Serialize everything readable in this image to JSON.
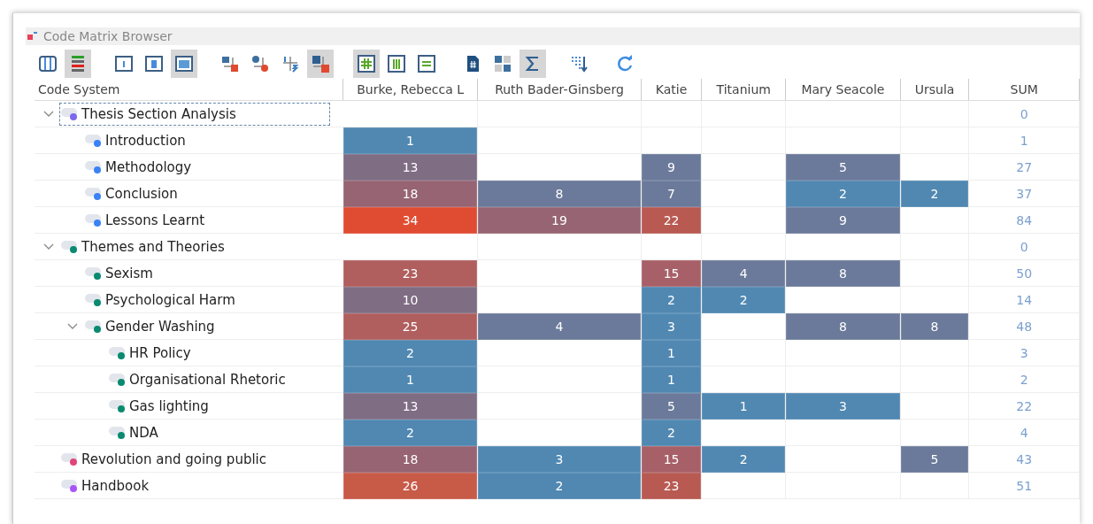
{
  "window": {
    "title": "Code Matrix Browser"
  },
  "toolbar": [
    [
      {
        "kind": "columns",
        "selected": false
      },
      {
        "kind": "bars",
        "selected": true
      }
    ],
    [
      {
        "kind": "frame-thin",
        "selected": false
      },
      {
        "kind": "frame-mid",
        "selected": false
      },
      {
        "kind": "frame-full",
        "selected": true
      }
    ],
    [
      {
        "kind": "square-link",
        "selected": false
      },
      {
        "kind": "circle-link",
        "selected": false
      },
      {
        "kind": "num-link",
        "selected": false
      },
      {
        "kind": "num-badge",
        "selected": true
      }
    ],
    [
      {
        "kind": "grid-hash",
        "selected": true
      },
      {
        "kind": "grid-cols",
        "selected": false
      },
      {
        "kind": "grid-rows",
        "selected": false
      }
    ],
    [
      {
        "kind": "doc-hash",
        "selected": false
      },
      {
        "kind": "tiles",
        "selected": false
      },
      {
        "kind": "sigma",
        "selected": true
      }
    ],
    [
      {
        "kind": "sort-down",
        "selected": false
      }
    ],
    [
      {
        "kind": "refresh",
        "selected": false
      }
    ]
  ],
  "columns": [
    "Code System",
    "Burke, Rebecca L",
    "Ruth Bader-Ginsberg",
    "Katie",
    "Titanium",
    "Mary Seacole",
    "Ursula",
    "SUM"
  ],
  "codes": [
    {
      "name": "Thesis Section Analysis",
      "color": "#7b68ee",
      "selected": true,
      "expanded": true,
      "cells": [
        null,
        null,
        null,
        null,
        null,
        null
      ],
      "sum": "0",
      "children": [
        {
          "name": "Introduction",
          "color": "#3b82f6",
          "selected": false,
          "cells": [
            {
              "value": "1",
              "color": "#5088b2"
            },
            null,
            null,
            null,
            null,
            null
          ],
          "sum": "1"
        },
        {
          "name": "Methodology",
          "color": "#3b82f6",
          "selected": false,
          "cells": [
            {
              "value": "13",
              "color": "#7f6d84"
            },
            null,
            {
              "value": "9",
              "color": "#6b7a9a"
            },
            null,
            {
              "value": "5",
              "color": "#6b7a9a"
            },
            null
          ],
          "sum": "27"
        },
        {
          "name": "Conclusion",
          "color": "#3b82f6",
          "selected": false,
          "cells": [
            {
              "value": "18",
              "color": "#966472"
            },
            {
              "value": "8",
              "color": "#6b7a9a"
            },
            {
              "value": "7",
              "color": "#6b7a9a"
            },
            null,
            {
              "value": "2",
              "color": "#5088b2"
            },
            {
              "value": "2",
              "color": "#5088b2"
            }
          ],
          "sum": "37"
        },
        {
          "name": "Lessons Learnt",
          "color": "#3b82f6",
          "selected": false,
          "cells": [
            {
              "value": "34",
              "color": "#e04c32"
            },
            {
              "value": "19",
              "color": "#966472"
            },
            {
              "value": "22",
              "color": "#b85a52"
            },
            null,
            {
              "value": "9",
              "color": "#6b7a9a"
            },
            null
          ],
          "sum": "84"
        }
      ]
    },
    {
      "name": "Themes and Theories",
      "color": "#0a8a70",
      "selected": false,
      "expanded": true,
      "cells": [
        null,
        null,
        null,
        null,
        null,
        null
      ],
      "sum": "0",
      "children": [
        {
          "name": "Sexism",
          "color": "#0a8a70",
          "selected": false,
          "cells": [
            {
              "value": "23",
              "color": "#b05e5e"
            },
            null,
            {
              "value": "15",
              "color": "#a86068"
            },
            {
              "value": "4",
              "color": "#6b7a9a"
            },
            {
              "value": "8",
              "color": "#6b7a9a"
            },
            null
          ],
          "sum": "50"
        },
        {
          "name": "Psychological Harm",
          "color": "#0a8a70",
          "selected": false,
          "cells": [
            {
              "value": "10",
              "color": "#7f6d84"
            },
            null,
            {
              "value": "2",
              "color": "#5088b2"
            },
            {
              "value": "2",
              "color": "#5088b2"
            },
            null,
            null
          ],
          "sum": "14"
        },
        {
          "name": "Gender Washing",
          "color": "#0a8a70",
          "selected": false,
          "expanded": true,
          "cells": [
            {
              "value": "25",
              "color": "#b05e5e"
            },
            {
              "value": "4",
              "color": "#6b7a9a"
            },
            {
              "value": "3",
              "color": "#5088b2"
            },
            null,
            {
              "value": "8",
              "color": "#6b7a9a"
            },
            {
              "value": "8",
              "color": "#6b7a9a"
            }
          ],
          "sum": "48",
          "children": [
            {
              "name": "HR Policy",
              "color": "#0a8a70",
              "selected": false,
              "cells": [
                {
                  "value": "2",
                  "color": "#5088b2"
                },
                null,
                {
                  "value": "1",
                  "color": "#5088b2"
                },
                null,
                null,
                null
              ],
              "sum": "3"
            },
            {
              "name": "Organisational Rhetoric",
              "color": "#0a8a70",
              "selected": false,
              "cells": [
                {
                  "value": "1",
                  "color": "#5088b2"
                },
                null,
                {
                  "value": "1",
                  "color": "#5088b2"
                },
                null,
                null,
                null
              ],
              "sum": "2"
            },
            {
              "name": "Gas lighting",
              "color": "#0a8a70",
              "selected": false,
              "cells": [
                {
                  "value": "13",
                  "color": "#7f6d84"
                },
                null,
                {
                  "value": "5",
                  "color": "#6b7a9a"
                },
                {
                  "value": "1",
                  "color": "#5088b2"
                },
                {
                  "value": "3",
                  "color": "#5088b2"
                },
                null
              ],
              "sum": "22"
            },
            {
              "name": "NDA",
              "color": "#0a8a70",
              "selected": false,
              "cells": [
                {
                  "value": "2",
                  "color": "#5088b2"
                },
                null,
                {
                  "value": "2",
                  "color": "#5088b2"
                },
                null,
                null,
                null
              ],
              "sum": "4"
            }
          ]
        }
      ]
    },
    {
      "name": "Revolution and going public",
      "color": "#e0457a",
      "selected": false,
      "cells": [
        {
          "value": "18",
          "color": "#966472"
        },
        {
          "value": "3",
          "color": "#5088b2"
        },
        {
          "value": "15",
          "color": "#a86068"
        },
        {
          "value": "2",
          "color": "#5088b2"
        },
        null,
        {
          "value": "5",
          "color": "#6b7a9a"
        }
      ],
      "sum": "43"
    },
    {
      "name": "Handbook",
      "color": "#a855f7",
      "selected": false,
      "cells": [
        {
          "value": "26",
          "color": "#c85a48"
        },
        {
          "value": "2",
          "color": "#5088b2"
        },
        {
          "value": "23",
          "color": "#b85a52"
        },
        null,
        null,
        null
      ],
      "sum": "51"
    }
  ]
}
